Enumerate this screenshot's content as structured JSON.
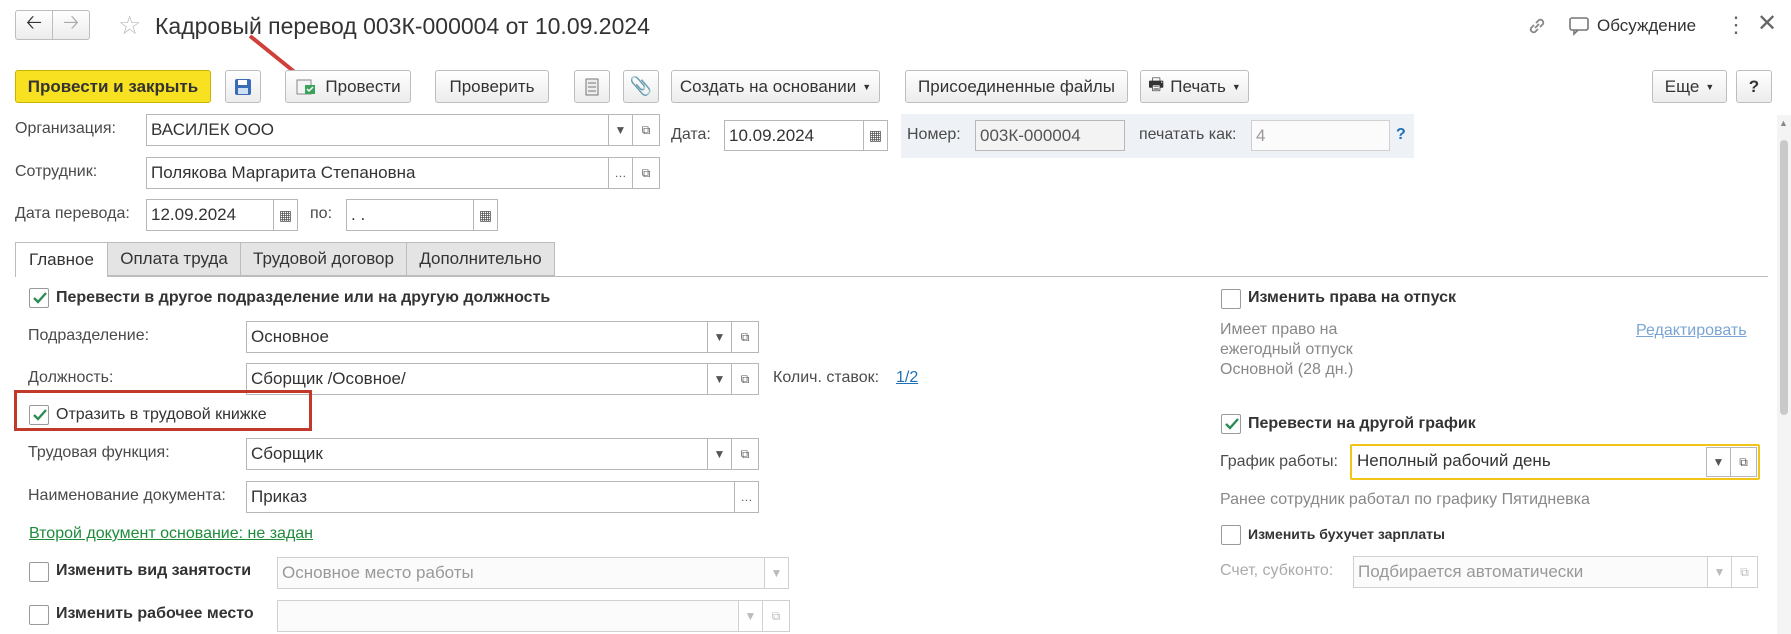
{
  "window": {
    "title": "Кадровый перевод 003К-000004 от 10.09.2024",
    "discussion": "Обсуждение"
  },
  "toolbar": {
    "post_close": "Провести и закрыть",
    "post": "Провести",
    "check": "Проверить",
    "create_based": "Создать на основании",
    "attached_files": "Присоединенные файлы",
    "print": "Печать",
    "more": "Еще",
    "help": "?"
  },
  "header": {
    "org_label": "Организация:",
    "org_value": "ВАСИЛЕК ООО",
    "date_label": "Дата:",
    "date_value": "10.09.2024",
    "number_label": "Номер:",
    "number_value": "003К-000004",
    "print_as_label": "печатать как:",
    "print_as_value": "4",
    "print_as_help": "?",
    "employee_label": "Сотрудник:",
    "employee_value": "Полякова Маргарита Степановна",
    "transfer_date_label": "Дата перевода:",
    "transfer_date_value": "12.09.2024",
    "to_label": "по:",
    "to_value": " .  ."
  },
  "tabs": [
    "Главное",
    "Оплата труда",
    "Трудовой договор",
    "Дополнительно"
  ],
  "main": {
    "transfer_checkbox": "Перевести в другое подразделение или на другую должность",
    "dept_label": "Подразделение:",
    "dept_value": "Основное",
    "position_label": "Должность:",
    "position_value": "Сборщик /Осовное/",
    "rates_label": "Колич. ставок:",
    "rates_value": "1/2",
    "workbook_checkbox": "Отразить в трудовой книжке",
    "labor_function_label": "Трудовая функция:",
    "labor_function_value": "Сборщик",
    "doc_name_label": "Наименование документа:",
    "doc_name_value": "Приказ",
    "second_doc_link": "Второй документ основание: не задан",
    "employment_type_checkbox": "Изменить вид занятости",
    "employment_type_value": "Основное место работы",
    "workplace_checkbox": "Изменить рабочее место",
    "workplace_value": ""
  },
  "right": {
    "vacation_checkbox": "Изменить права на отпуск",
    "vacation_info": "Имеет право на ежегодный отпуск Основной (28 дн.)",
    "vacation_edit": "Редактировать",
    "schedule_checkbox": "Перевести на другой график",
    "schedule_label": "График работы:",
    "schedule_value": "Неполный рабочий день",
    "schedule_info": "Ранее сотрудник работал по графику Пятидневка",
    "accounting_checkbox": "Изменить бухучет зарплаты",
    "account_label": "Счет, субконто:",
    "account_value": "Подбирается автоматически"
  },
  "colors": {
    "primary_button": "#f8e121",
    "highlight_box": "#c0392b",
    "focus_border": "#f0c419",
    "link": "#1f6fb5",
    "green_link": "#1e8b3a",
    "check": "#2e8b57"
  }
}
